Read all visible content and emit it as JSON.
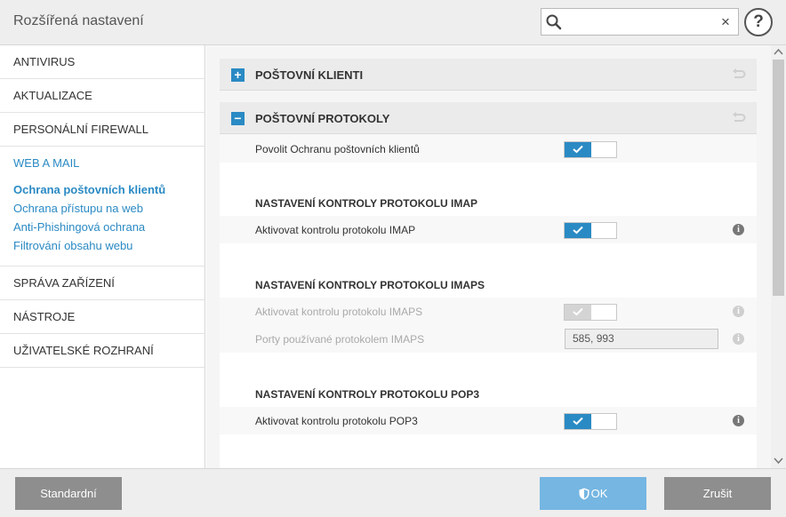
{
  "window": {
    "title": "Rozšířená nastavení"
  },
  "search": {
    "value": "",
    "placeholder": "",
    "clear_label": "×"
  },
  "help": {
    "label": "?"
  },
  "sidebar": {
    "items_top": [
      {
        "label": "ANTIVIRUS"
      },
      {
        "label": "AKTUALIZACE"
      },
      {
        "label": "PERSONÁLNÍ FIREWALL"
      }
    ],
    "group": {
      "label": "WEB A MAIL",
      "subitems": [
        {
          "label": "Ochrana poštovních klientů",
          "active": true
        },
        {
          "label": "Ochrana přístupu na web"
        },
        {
          "label": "Anti-Phishingová ochrana"
        },
        {
          "label": "Filtrování obsahu webu"
        }
      ]
    },
    "items_bottom": [
      {
        "label": "SPRÁVA ZAŘÍZENÍ"
      },
      {
        "label": "NÁSTROJE"
      },
      {
        "label": "UŽIVATELSKÉ ROZHRANÍ"
      }
    ]
  },
  "sections": {
    "mail_clients": {
      "title": "POŠTOVNÍ KLIENTI",
      "toggle": "+"
    },
    "mail_protocols": {
      "title": "POŠTOVNÍ PROTOKOLY",
      "toggle": "−"
    }
  },
  "settings": {
    "enable_protection": {
      "label": "Povolit Ochranu poštovních klientů",
      "checked": true
    },
    "imap_heading": "NASTAVENÍ KONTROLY PROTOKOLU IMAP",
    "imap_enable": {
      "label": "Aktivovat kontrolu protokolu IMAP",
      "checked": true
    },
    "imaps_heading": "NASTAVENÍ KONTROLY PROTOKOLU IMAPS",
    "imaps_enable": {
      "label": "Aktivovat kontrolu protokolu IMAPS",
      "checked": true,
      "disabled": true
    },
    "imaps_ports": {
      "label": "Porty používané protokolem IMAPS",
      "value": "585, 993",
      "disabled": true
    },
    "pop3_heading": "NASTAVENÍ KONTROLY PROTOKOLU POP3",
    "pop3_enable": {
      "label": "Aktivovat kontrolu protokolu POP3",
      "checked": true
    }
  },
  "footer": {
    "default_label": "Standardní",
    "ok_label": "OK",
    "cancel_label": "Zrušit"
  },
  "colors": {
    "accent": "#2a8ac4",
    "ok_button": "#75b6e2",
    "gray_button": "#8e8e8e"
  }
}
